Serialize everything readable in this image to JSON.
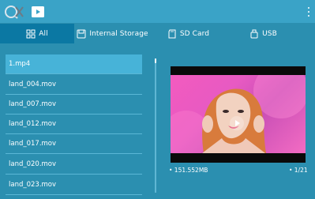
{
  "topbar": {
    "logo_icon": "qx-logo-icon",
    "app_icon": "video-player-icon",
    "menu_icon": "overflow-menu-icon"
  },
  "tabs": [
    {
      "label": "All",
      "icon": "grid-icon",
      "active": true
    },
    {
      "label": "Internal Storage",
      "icon": "storage-icon",
      "active": false
    },
    {
      "label": "SD Card",
      "icon": "sd-card-icon",
      "active": false
    },
    {
      "label": "USB",
      "icon": "usb-icon",
      "active": false
    }
  ],
  "files": [
    {
      "name": "1.mp4",
      "selected": true
    },
    {
      "name": "land_004.mov",
      "selected": false
    },
    {
      "name": "land_007.mov",
      "selected": false
    },
    {
      "name": "land_012.mov",
      "selected": false
    },
    {
      "name": "land_017.mov",
      "selected": false
    },
    {
      "name": "land_020.mov",
      "selected": false
    },
    {
      "name": "land_023.mov",
      "selected": false
    }
  ],
  "preview": {
    "play_icon": "play-icon",
    "file_size": "• 151.552MB",
    "page_indicator": "• 1/21"
  },
  "colors": {
    "background": "#2b8fb0",
    "topbar": "#3aa3c7",
    "tab_active": "#0b78a3",
    "selected_item": "#47b3d8",
    "divider": "#5ab7d6",
    "video_bg": "#f35bbf"
  }
}
